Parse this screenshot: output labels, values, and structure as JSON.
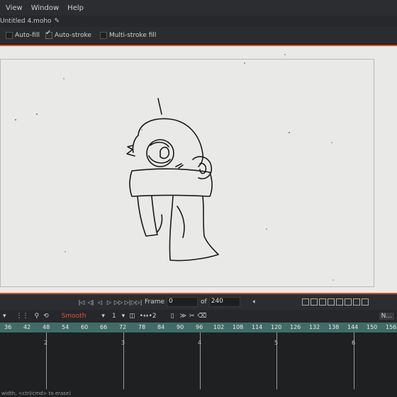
{
  "menubar": {
    "items": [
      "View",
      "Window",
      "Help"
    ]
  },
  "document": {
    "title": "Untitled 4.moho"
  },
  "toolbar": {
    "options": [
      {
        "label": "Auto-fill",
        "checked": false
      },
      {
        "label": "Auto-stroke",
        "checked": true
      },
      {
        "label": "Multi-stroke fill",
        "checked": false
      }
    ]
  },
  "transport": {
    "frame_label": "Frame",
    "frame_value": "0",
    "of_label": "of",
    "total_frames": "240"
  },
  "layerbar": {
    "interpolation": "Smooth",
    "step_value": "1",
    "onion_value": "2",
    "overflow_label": "N..."
  },
  "ruler": {
    "ticks": [
      "36",
      "42",
      "48",
      "54",
      "60",
      "66",
      "72",
      "78",
      "84",
      "90",
      "96",
      "102",
      "108",
      "114",
      "120",
      "126",
      "132",
      "138",
      "144",
      "150",
      "156"
    ]
  },
  "timeline": {
    "seconds": [
      "2",
      "3",
      "4",
      "5",
      "6"
    ]
  },
  "colors": {
    "stage_border": "#d24a2f",
    "ruler_bg": "#3f6d66",
    "smooth_text": "#e0533d"
  },
  "statusbar": {
    "text": "width, <ctrl/cmd> to erase)"
  }
}
